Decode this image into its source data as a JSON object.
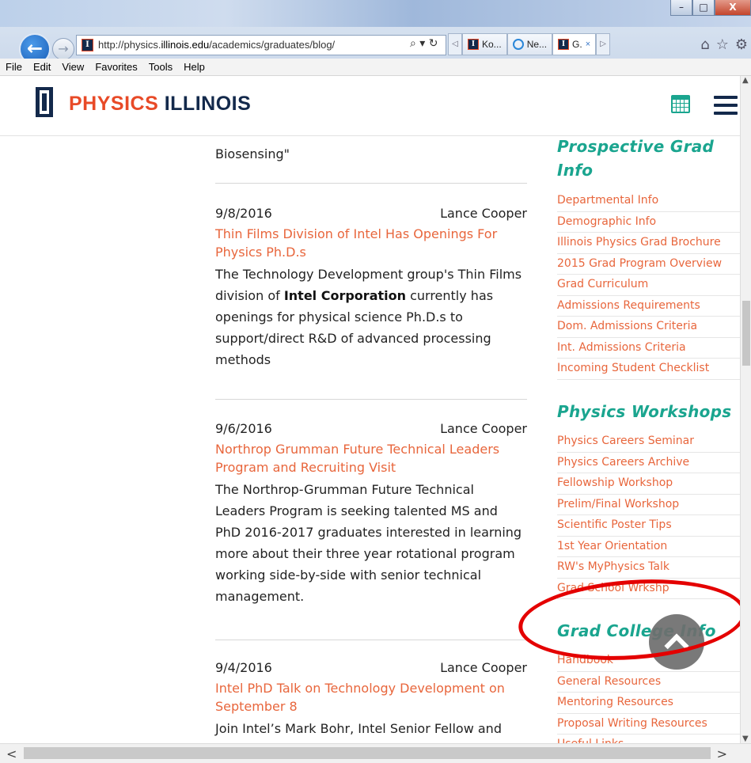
{
  "browser": {
    "window_buttons": {
      "minimize": "–",
      "maximize": "□",
      "close": "X"
    },
    "back_icon": "back-arrow-icon",
    "forward_icon": "forward-arrow-icon",
    "url_prefix": "http://physics.",
    "url_domain": "illinois.edu",
    "url_path": "/academics/graduates/blog/",
    "address_controls": "⌕ ▾ ↻",
    "tab_prev": "◁",
    "tab_next": "▷",
    "tabs": [
      {
        "label": "Ko...",
        "icon": "illinois-favicon"
      },
      {
        "label": "Ne...",
        "icon": "ie-favicon"
      },
      {
        "label": "G.",
        "close": "×",
        "icon": "illinois-favicon",
        "active": true
      }
    ],
    "tools": {
      "home": "⌂",
      "favorites": "☆",
      "settings": "⚙"
    },
    "menu": [
      "File",
      "Edit",
      "View",
      "Favorites",
      "Tools",
      "Help"
    ]
  },
  "site": {
    "brand_part1": "PHYSICS",
    "brand_part2": "ILLINOIS",
    "logo_letter": "I"
  },
  "main": {
    "lead_text": "Biosensing\"",
    "posts": [
      {
        "date": "9/8/2016",
        "author": "Lance Cooper",
        "title": "Thin Films Division of Intel Has Openings For Physics Ph.D.s",
        "body_1": "The Technology Development group's Thin Films division of ",
        "body_bold": "Intel Corporation",
        "body_2": " currently has openings for physical science Ph.D.s to support/direct R&D of advanced processing methods"
      },
      {
        "date": "9/6/2016",
        "author": "Lance Cooper",
        "title": "Northrop Grumman Future Technical Leaders Program and Recruiting Visit",
        "body": "The Northrop-Grumman Future Technical Leaders Program is seeking talented MS and PhD 2016-2017 graduates interested in learning more about their three year rotational program working side-by-side with senior technical management."
      },
      {
        "date": "9/4/2016",
        "author": "Lance Cooper",
        "title": "Intel PhD Talk on Technology Development on September 8",
        "body": "Join Intel’s Mark Bohr, Intel Senior Fellow and"
      }
    ]
  },
  "sidebar": {
    "sections": [
      {
        "heading": "Prospective Grad Info",
        "links": [
          "Departmental Info",
          "Demographic Info",
          "Illinois Physics Grad Brochure",
          "2015 Grad Program Overview",
          "Grad Curriculum",
          "Admissions Requirements",
          "Dom. Admissions Criteria",
          "Int. Admissions Criteria",
          "Incoming Student Checklist"
        ]
      },
      {
        "heading": "Physics Workshops",
        "links": [
          "Physics Careers Seminar",
          "Physics Careers Archive",
          "Fellowship Workshop",
          "Prelim/Final Workshop",
          "Scientific Poster Tips",
          "1st Year Orientation",
          "RW's MyPhysics Talk",
          "Grad School Wrkshp"
        ]
      },
      {
        "heading": "Grad College Info",
        "links": [
          "Handbook",
          "General Resources",
          "Mentoring Resources",
          "Proposal Writing Resources",
          "Useful Links"
        ]
      }
    ]
  },
  "scrollbars": {
    "left_arrow": "<",
    "right_arrow": ">",
    "up_arrow": "▲",
    "down_arrow": "▼"
  },
  "colors": {
    "accent_orange": "#e8663c",
    "brand_navy": "#13294b",
    "brand_orange": "#e84a27",
    "teal_heading": "#1aa58f",
    "annotation_red": "#e40000"
  }
}
